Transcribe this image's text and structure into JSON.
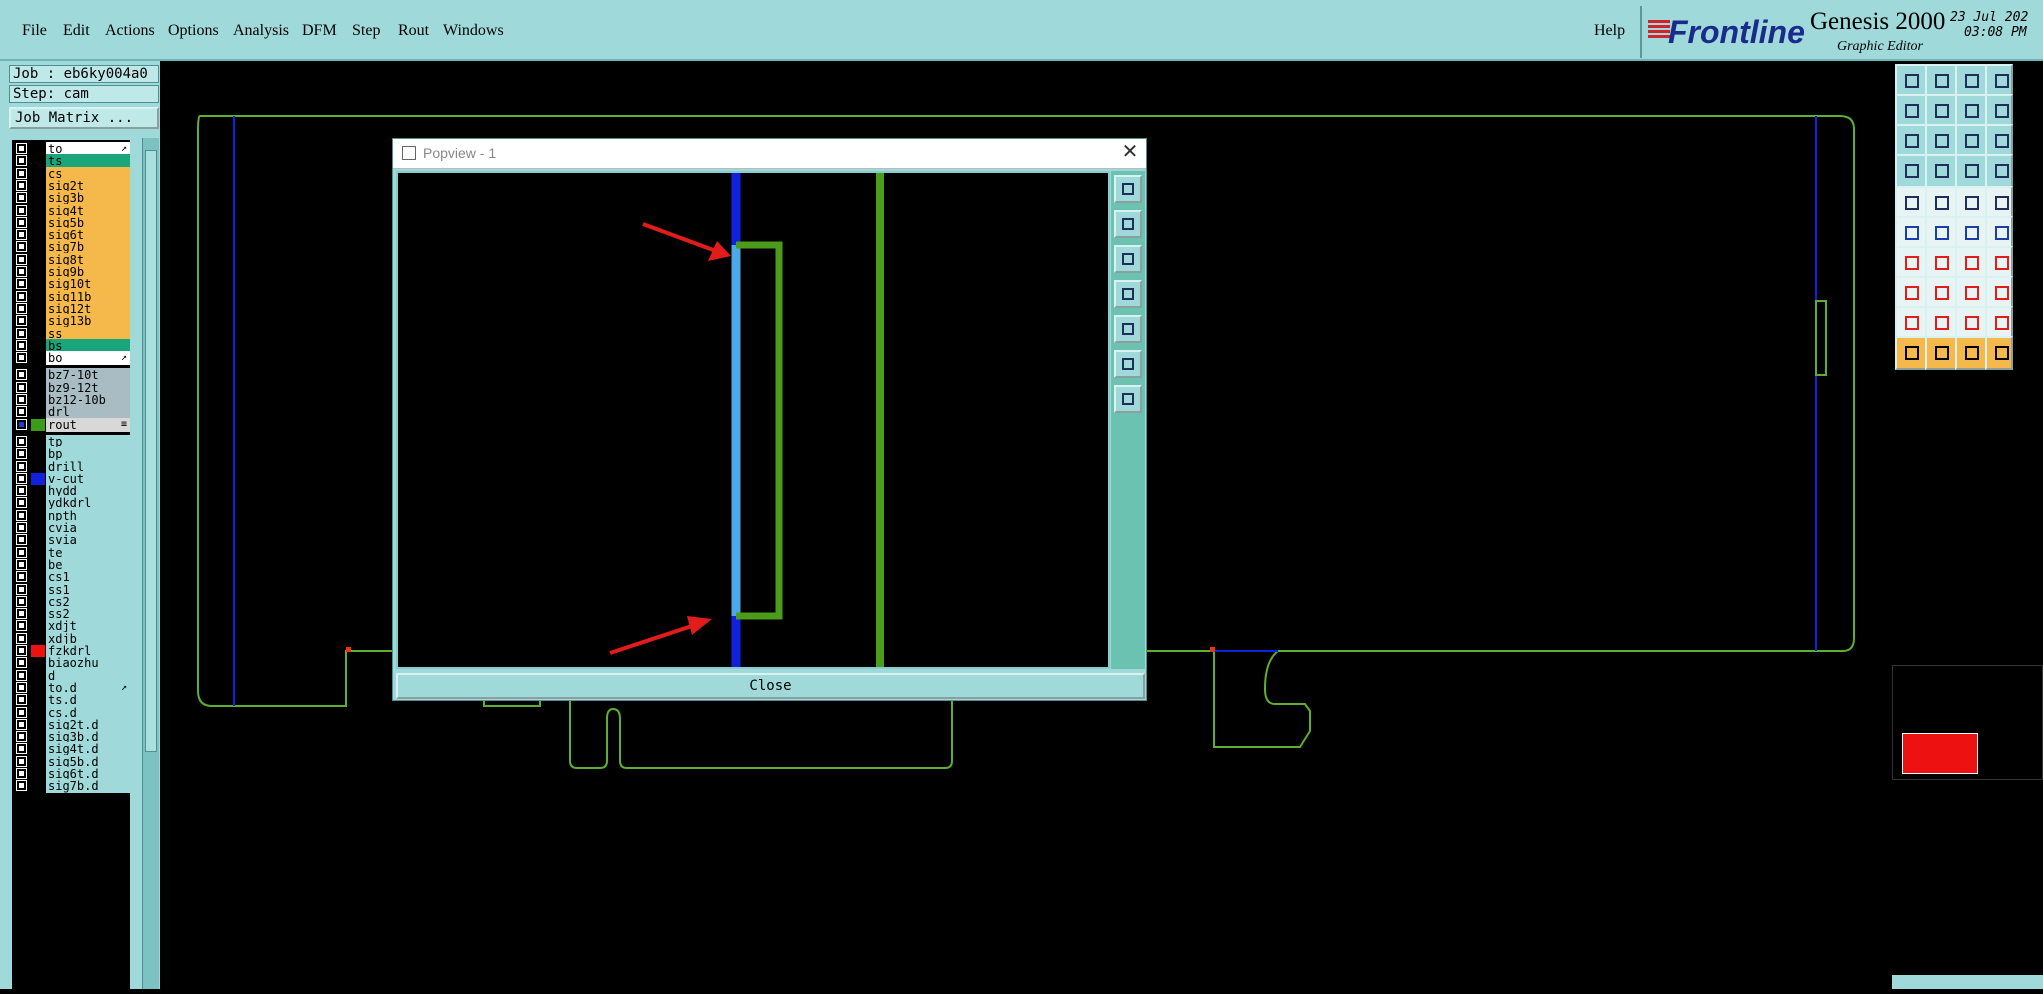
{
  "menu": [
    "File",
    "Edit",
    "Actions",
    "Options",
    "Analysis",
    "DFM",
    "Step",
    "Rout",
    "Windows"
  ],
  "help": "Help",
  "brand": {
    "logo": "Frontline",
    "title": "Genesis 2000",
    "subtitle": "Graphic Editor",
    "date": "23 Jul 202",
    "time": "03:08 PM"
  },
  "job": {
    "job_label": "Job : eb6ky004a0",
    "step_label": "Step: cam",
    "matrix_button": "Job Matrix ..."
  },
  "layers": [
    {
      "name": "to",
      "bg": "#ffffff",
      "sw": "",
      "mark": "arrow"
    },
    {
      "name": "ts",
      "bg": "#1aa57a",
      "sw": ""
    },
    {
      "name": "cs",
      "bg": "#f5b84a",
      "sw": ""
    },
    {
      "name": "sig2t",
      "bg": "#f5b84a",
      "sw": ""
    },
    {
      "name": "sig3b",
      "bg": "#f5b84a",
      "sw": ""
    },
    {
      "name": "sig4t",
      "bg": "#f5b84a",
      "sw": ""
    },
    {
      "name": "sig5b",
      "bg": "#f5b84a",
      "sw": ""
    },
    {
      "name": "sig6t",
      "bg": "#f5b84a",
      "sw": ""
    },
    {
      "name": "sig7b",
      "bg": "#f5b84a",
      "sw": ""
    },
    {
      "name": "sig8t",
      "bg": "#f5b84a",
      "sw": ""
    },
    {
      "name": "sig9b",
      "bg": "#f5b84a",
      "sw": ""
    },
    {
      "name": "sig10t",
      "bg": "#f5b84a",
      "sw": ""
    },
    {
      "name": "sig11b",
      "bg": "#f5b84a",
      "sw": ""
    },
    {
      "name": "sig12t",
      "bg": "#f5b84a",
      "sw": ""
    },
    {
      "name": "sig13b",
      "bg": "#f5b84a",
      "sw": ""
    },
    {
      "name": "ss",
      "bg": "#f5b84a",
      "sw": ""
    },
    {
      "name": "bs",
      "bg": "#1aa57a",
      "sw": ""
    },
    {
      "name": "bo",
      "bg": "#ffffff",
      "sw": "",
      "mark": "arrow"
    },
    {
      "gap": true
    },
    {
      "name": "bz7-10t",
      "bg": "#a9bcc4",
      "sw": ""
    },
    {
      "name": "bz9-12t",
      "bg": "#a9bcc4",
      "sw": ""
    },
    {
      "name": "bz12-10b",
      "bg": "#a9bcc4",
      "sw": ""
    },
    {
      "name": "drl",
      "bg": "#a9bcc4",
      "sw": ""
    },
    {
      "name": "rout",
      "bg": "#d8d8d8",
      "sw": "#3d9c1a",
      "cb": "#1d3fcc",
      "mark": "hash"
    },
    {
      "gap": true
    },
    {
      "name": "tp",
      "bg": "#9fd9d9",
      "sw": ""
    },
    {
      "name": "bp",
      "bg": "#9fd9d9",
      "sw": ""
    },
    {
      "name": "drill",
      "bg": "#9fd9d9",
      "sw": ""
    },
    {
      "name": "v-cut",
      "bg": "#9fd9d9",
      "sw": "#1022dd"
    },
    {
      "name": "hydd",
      "bg": "#9fd9d9",
      "sw": ""
    },
    {
      "name": "ydkdrl",
      "bg": "#9fd9d9",
      "sw": ""
    },
    {
      "name": "npth",
      "bg": "#9fd9d9",
      "sw": ""
    },
    {
      "name": "cvia",
      "bg": "#9fd9d9",
      "sw": ""
    },
    {
      "name": "svia",
      "bg": "#9fd9d9",
      "sw": ""
    },
    {
      "name": "te",
      "bg": "#9fd9d9",
      "sw": ""
    },
    {
      "name": "be",
      "bg": "#9fd9d9",
      "sw": ""
    },
    {
      "name": "cs1",
      "bg": "#9fd9d9",
      "sw": ""
    },
    {
      "name": "ss1",
      "bg": "#9fd9d9",
      "sw": ""
    },
    {
      "name": "cs2",
      "bg": "#9fd9d9",
      "sw": ""
    },
    {
      "name": "ss2",
      "bg": "#9fd9d9",
      "sw": ""
    },
    {
      "name": "xdjt",
      "bg": "#9fd9d9",
      "sw": ""
    },
    {
      "name": "xdjb",
      "bg": "#9fd9d9",
      "sw": ""
    },
    {
      "name": "fzkdrl",
      "bg": "#9fd9d9",
      "sw": "#ee1111"
    },
    {
      "name": "biaozhu",
      "bg": "#9fd9d9",
      "sw": ""
    },
    {
      "name": "d",
      "bg": "#9fd9d9",
      "sw": ""
    },
    {
      "name": "to.d",
      "bg": "#9fd9d9",
      "sw": "",
      "mark": "arrow"
    },
    {
      "name": "ts.d",
      "bg": "#9fd9d9",
      "sw": ""
    },
    {
      "name": "cs.d",
      "bg": "#9fd9d9",
      "sw": ""
    },
    {
      "name": "sig2t.d",
      "bg": "#9fd9d9",
      "sw": ""
    },
    {
      "name": "sig3b.d",
      "bg": "#9fd9d9",
      "sw": ""
    },
    {
      "name": "sig4t.d",
      "bg": "#9fd9d9",
      "sw": ""
    },
    {
      "name": "sig5b.d",
      "bg": "#9fd9d9",
      "sw": ""
    },
    {
      "name": "sig6t.d",
      "bg": "#9fd9d9",
      "sw": ""
    },
    {
      "name": "sig7b.d",
      "bg": "#9fd9d9",
      "sw": ""
    }
  ],
  "popview": {
    "title": "Popview - 1",
    "close_label": "Close"
  },
  "colors": {
    "panel": "#9fd9d9",
    "outline": "#5fae2f",
    "vcut": "#1022dd",
    "selected": "#4aa9e6",
    "annotation": "#e21b1b"
  }
}
